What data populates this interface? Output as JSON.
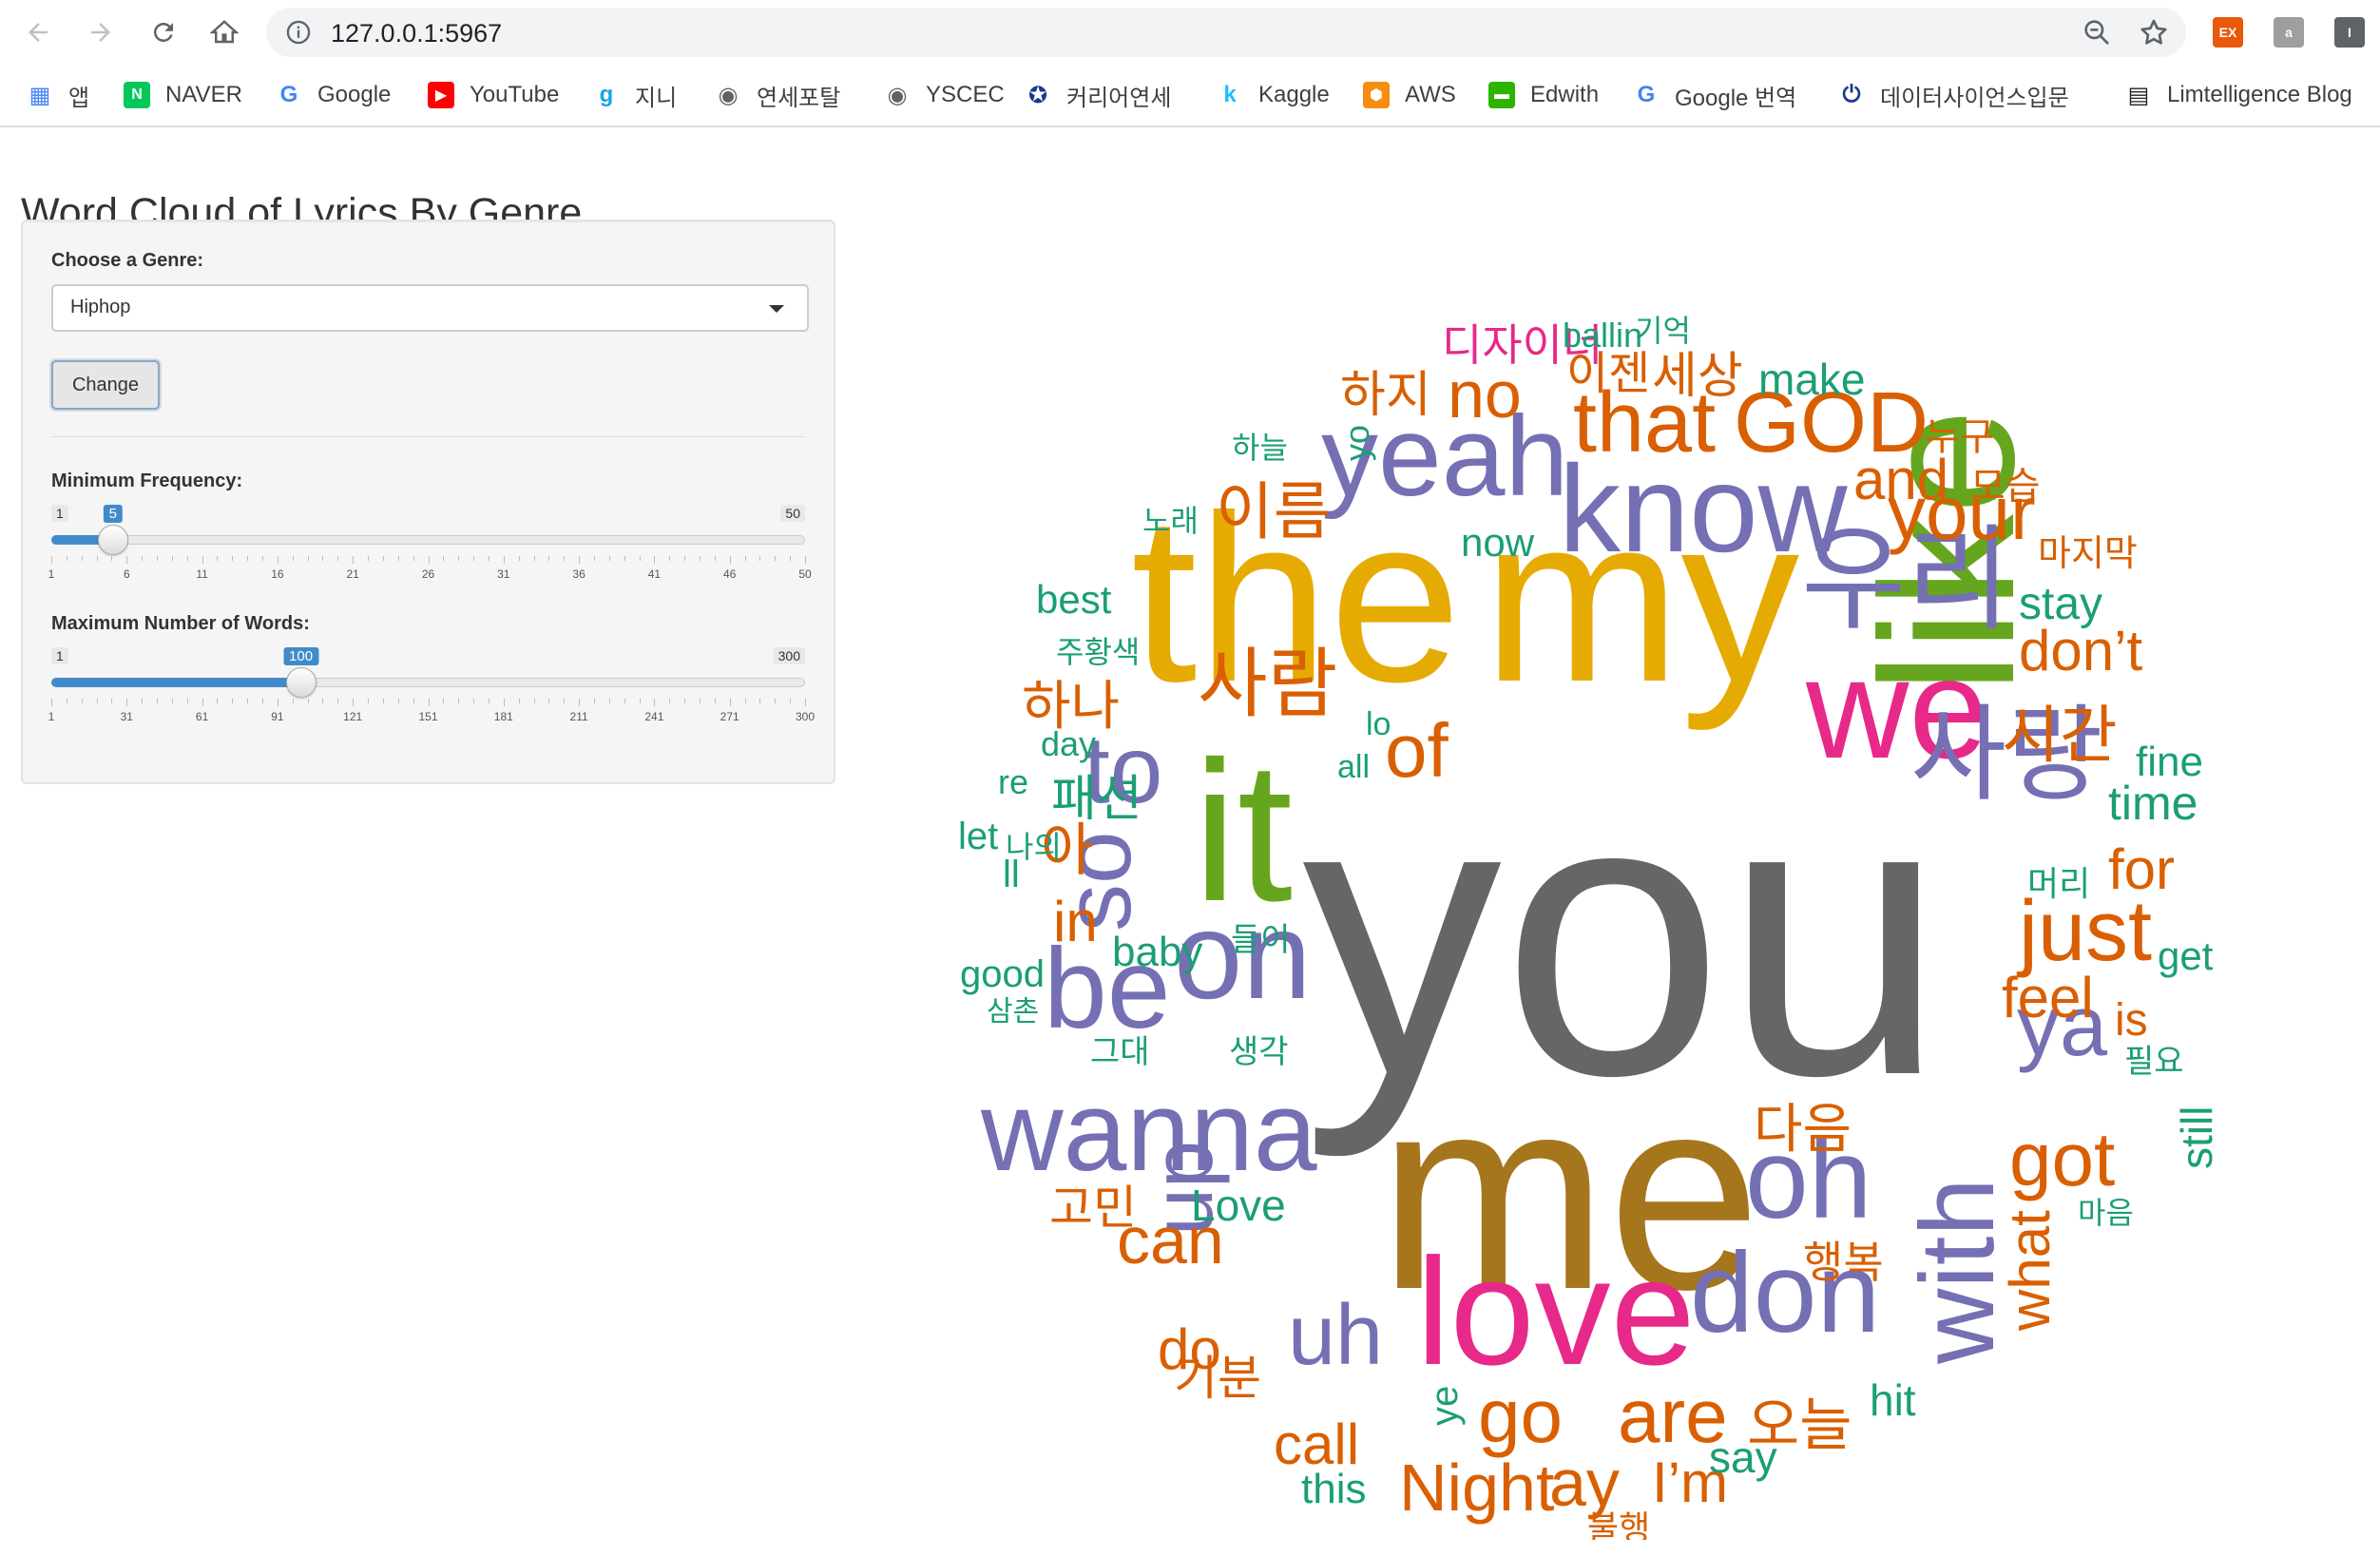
{
  "browser": {
    "url": "127.0.0.1:5967",
    "extensions": [
      {
        "label": "EX",
        "color": "#e8590c"
      },
      {
        "label": "a",
        "color": "#9e9e9e"
      },
      {
        "label": "I",
        "color": "#5f6368"
      }
    ],
    "bookmarks": [
      {
        "label": "앱",
        "icon": "apps-grid-icon",
        "color": "#4285f4"
      },
      {
        "label": "NAVER",
        "icon": "naver-icon",
        "color": "#03c75a"
      },
      {
        "label": "Google",
        "icon": "google-icon",
        "color": "#4285f4"
      },
      {
        "label": "YouTube",
        "icon": "youtube-icon",
        "color": "#ff0000"
      },
      {
        "label": "지니",
        "icon": "genie-icon",
        "color": "#1aa3e8"
      },
      {
        "label": "연세포탈",
        "icon": "globe-icon",
        "color": "#5f6368"
      },
      {
        "label": "YSCEC",
        "icon": "globe-icon",
        "color": "#5f6368"
      },
      {
        "label": "커리어연세",
        "icon": "yonsei-icon",
        "color": "#1a3a8c"
      },
      {
        "label": "Kaggle",
        "icon": "kaggle-icon",
        "color": "#20beff"
      },
      {
        "label": "AWS",
        "icon": "aws-icon",
        "color": "#f68d11"
      },
      {
        "label": "Edwith",
        "icon": "edwith-icon",
        "color": "#2db400"
      },
      {
        "label": "Google 번역",
        "icon": "translate-icon",
        "color": "#4285f4"
      },
      {
        "label": "데이터사이언스입문",
        "icon": "power-icon",
        "color": "#1a3a8c"
      },
      {
        "label": "Limtelligence Blog",
        "icon": "book-icon",
        "color": "#202124"
      }
    ]
  },
  "app": {
    "title": "Word Cloud of Lyrics By Genre",
    "genre_label": "Choose a Genre:",
    "genre_value": "Hiphop",
    "change_button": "Change",
    "min_freq": {
      "label": "Minimum Frequency:",
      "min": 1,
      "max": 50,
      "value": 5,
      "ticks": [
        1,
        6,
        11,
        16,
        21,
        26,
        31,
        36,
        41,
        46,
        50
      ]
    },
    "max_words": {
      "label": "Maximum Number of Words:",
      "min": 1,
      "max": 300,
      "value": 100,
      "ticks": [
        1,
        31,
        61,
        91,
        121,
        151,
        181,
        211,
        241,
        271,
        300
      ]
    }
  },
  "colors": {
    "orange": "#d95f02",
    "purple": "#7570b3",
    "teal": "#1b9e77",
    "pink": "#e7298a",
    "green": "#66a61e",
    "gold": "#e6ab02",
    "brown": "#a6761d",
    "gray": "#666666"
  },
  "wordcloud": [
    {
      "text": "you",
      "color": "gray"
    },
    {
      "text": "me",
      "color": "brown"
    },
    {
      "text": "the",
      "color": "gold"
    },
    {
      "text": "my",
      "color": "gold"
    },
    {
      "text": "like",
      "color": "green"
    },
    {
      "text": "it",
      "color": "green"
    },
    {
      "text": "love",
      "color": "pink"
    },
    {
      "text": "we",
      "color": "pink"
    },
    {
      "text": "know",
      "color": "purple"
    },
    {
      "text": "wanna",
      "color": "purple"
    },
    {
      "text": "on",
      "color": "purple"
    },
    {
      "text": "don",
      "color": "purple"
    },
    {
      "text": "with",
      "color": "purple"
    },
    {
      "text": "oh",
      "color": "purple"
    },
    {
      "text": "yeah",
      "color": "purple"
    },
    {
      "text": "우리",
      "color": "purple"
    },
    {
      "text": "사랑",
      "color": "purple"
    },
    {
      "text": "be",
      "color": "purple"
    },
    {
      "text": "so",
      "color": "purple"
    },
    {
      "text": "up",
      "color": "purple"
    },
    {
      "text": "uh",
      "color": "purple"
    },
    {
      "text": "ya",
      "color": "purple"
    },
    {
      "text": "to",
      "color": "purple"
    },
    {
      "text": "that",
      "color": "orange"
    },
    {
      "text": "GOD",
      "color": "orange"
    },
    {
      "text": "your",
      "color": "orange"
    },
    {
      "text": "just",
      "color": "orange"
    },
    {
      "text": "사람",
      "color": "orange"
    },
    {
      "text": "are",
      "color": "orange"
    },
    {
      "text": "go",
      "color": "orange"
    },
    {
      "text": "can",
      "color": "orange"
    },
    {
      "text": "got",
      "color": "orange"
    },
    {
      "text": "no",
      "color": "orange"
    },
    {
      "text": "of",
      "color": "orange"
    },
    {
      "text": "and",
      "color": "orange"
    },
    {
      "text": "don’t",
      "color": "orange"
    },
    {
      "text": "for",
      "color": "orange"
    },
    {
      "text": "feel",
      "color": "orange"
    },
    {
      "text": "what",
      "color": "orange"
    },
    {
      "text": "Night",
      "color": "orange"
    },
    {
      "text": "ay",
      "color": "orange"
    },
    {
      "text": "I’m",
      "color": "orange"
    },
    {
      "text": "call",
      "color": "orange"
    },
    {
      "text": "do",
      "color": "orange"
    },
    {
      "text": "in",
      "color": "orange"
    },
    {
      "text": "시간",
      "color": "orange"
    },
    {
      "text": "이름",
      "color": "orange"
    },
    {
      "text": "하지",
      "color": "orange"
    },
    {
      "text": "하나",
      "color": "orange"
    },
    {
      "text": "아",
      "color": "orange"
    },
    {
      "text": "다음",
      "color": "orange"
    },
    {
      "text": "오늘",
      "color": "orange"
    },
    {
      "text": "고민",
      "color": "orange"
    },
    {
      "text": "기분",
      "color": "orange"
    },
    {
      "text": "행복",
      "color": "orange"
    },
    {
      "text": "is",
      "color": "orange"
    },
    {
      "text": "이젠",
      "color": "orange"
    },
    {
      "text": "세상",
      "color": "orange"
    },
    {
      "text": "누구",
      "color": "orange"
    },
    {
      "text": "모습",
      "color": "orange"
    },
    {
      "text": "마지막",
      "color": "orange"
    },
    {
      "text": "불행",
      "color": "orange"
    },
    {
      "text": "디자이너",
      "color": "pink"
    },
    {
      "text": "make",
      "color": "teal"
    },
    {
      "text": "now",
      "color": "teal"
    },
    {
      "text": "stay",
      "color": "teal"
    },
    {
      "text": "fine",
      "color": "teal"
    },
    {
      "text": "time",
      "color": "teal"
    },
    {
      "text": "get",
      "color": "teal"
    },
    {
      "text": "still",
      "color": "teal"
    },
    {
      "text": "best",
      "color": "teal"
    },
    {
      "text": "Love",
      "color": "teal"
    },
    {
      "text": "hit",
      "color": "teal"
    },
    {
      "text": "say",
      "color": "teal"
    },
    {
      "text": "this",
      "color": "teal"
    },
    {
      "text": "baby",
      "color": "teal"
    },
    {
      "text": "ye",
      "color": "teal"
    },
    {
      "text": "yo",
      "color": "teal"
    },
    {
      "text": "day",
      "color": "teal"
    },
    {
      "text": "re",
      "color": "teal"
    },
    {
      "text": "all",
      "color": "teal"
    },
    {
      "text": "lo",
      "color": "teal"
    },
    {
      "text": "ll",
      "color": "teal"
    },
    {
      "text": "let",
      "color": "teal"
    },
    {
      "text": "good",
      "color": "teal"
    },
    {
      "text": "ballin",
      "color": "teal"
    },
    {
      "text": "기억",
      "color": "teal"
    },
    {
      "text": "하늘",
      "color": "teal"
    },
    {
      "text": "노래",
      "color": "teal"
    },
    {
      "text": "주황색",
      "color": "teal"
    },
    {
      "text": "나의",
      "color": "teal"
    },
    {
      "text": "들이",
      "color": "teal"
    },
    {
      "text": "삼촌",
      "color": "teal"
    },
    {
      "text": "그대",
      "color": "teal"
    },
    {
      "text": "생각",
      "color": "teal"
    },
    {
      "text": "머리",
      "color": "teal"
    },
    {
      "text": "필요",
      "color": "teal"
    },
    {
      "text": "마음",
      "color": "teal"
    },
    {
      "text": "패션",
      "color": "teal"
    },
    {
      "text": "ㄹ",
      "color": "purple"
    }
  ]
}
